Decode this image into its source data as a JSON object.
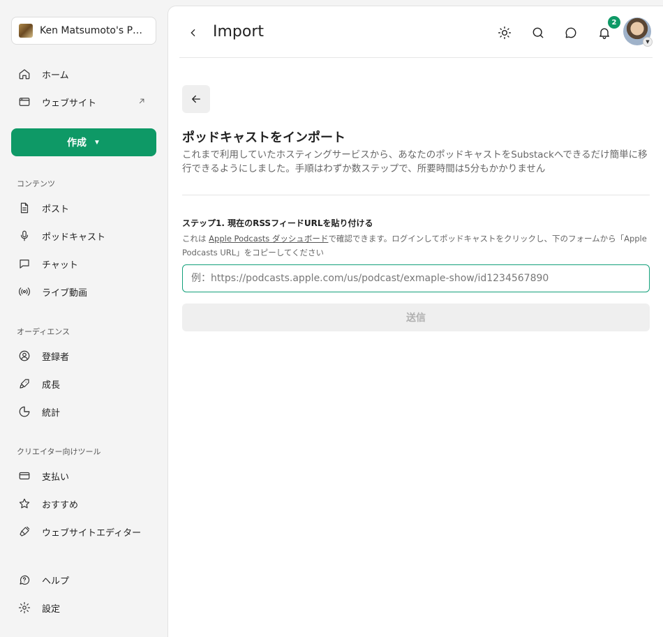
{
  "sidebar": {
    "publication_name": "Ken Matsumoto's PO...",
    "nav_top": [
      {
        "label": "ホーム",
        "icon": "home-icon"
      },
      {
        "label": "ウェブサイト",
        "icon": "browser-window-icon"
      }
    ],
    "create_label": "作成",
    "sections": [
      {
        "label": "コンテンツ",
        "items": [
          {
            "label": "ポスト",
            "icon": "document-icon"
          },
          {
            "label": "ポッドキャスト",
            "icon": "microphone-icon"
          },
          {
            "label": "チャット",
            "icon": "chat-bubble-icon"
          },
          {
            "label": "ライブ動画",
            "icon": "broadcast-icon"
          }
        ]
      },
      {
        "label": "オーディエンス",
        "items": [
          {
            "label": "登録者",
            "icon": "user-circle-icon"
          },
          {
            "label": "成長",
            "icon": "rocket-icon"
          },
          {
            "label": "統計",
            "icon": "pie-chart-icon"
          }
        ]
      },
      {
        "label": "クリエイター向けツール",
        "items": [
          {
            "label": "支払い",
            "icon": "credit-card-icon"
          },
          {
            "label": "おすすめ",
            "icon": "star-icon"
          },
          {
            "label": "ウェブサイトエディター",
            "icon": "paintbrush-icon"
          }
        ]
      }
    ],
    "nav_bottom": [
      {
        "label": "ヘルプ",
        "icon": "help-icon"
      },
      {
        "label": "設定",
        "icon": "gear-icon"
      }
    ]
  },
  "header": {
    "title": "Import",
    "notification_count": "2"
  },
  "content": {
    "heading": "ポッドキャストをインポート",
    "description": "これまで利用していたホスティングサービスから、あなたのポッドキャストをSubstackへできるだけ簡単に移行できるようにしました。手順はわずか数ステップで、所要時間は5分もかかりません",
    "step_title": "ステップ1.  現在のRSSフィードURLを貼り付ける",
    "step_help_prefix": "これは ",
    "step_help_link": "Apple Podcasts ダッシュボード",
    "step_help_suffix": "で確認できます。ログインしてポッドキャストをクリックし、下のフォームから「Apple Podcasts URL」をコピーしてください",
    "input_placeholder": "例：https://podcasts.apple.com/us/podcast/exmaple-show/id1234567890",
    "submit_label": "送信"
  },
  "colors": {
    "accent": "#0e9966",
    "input_focus": "#12a07a"
  }
}
